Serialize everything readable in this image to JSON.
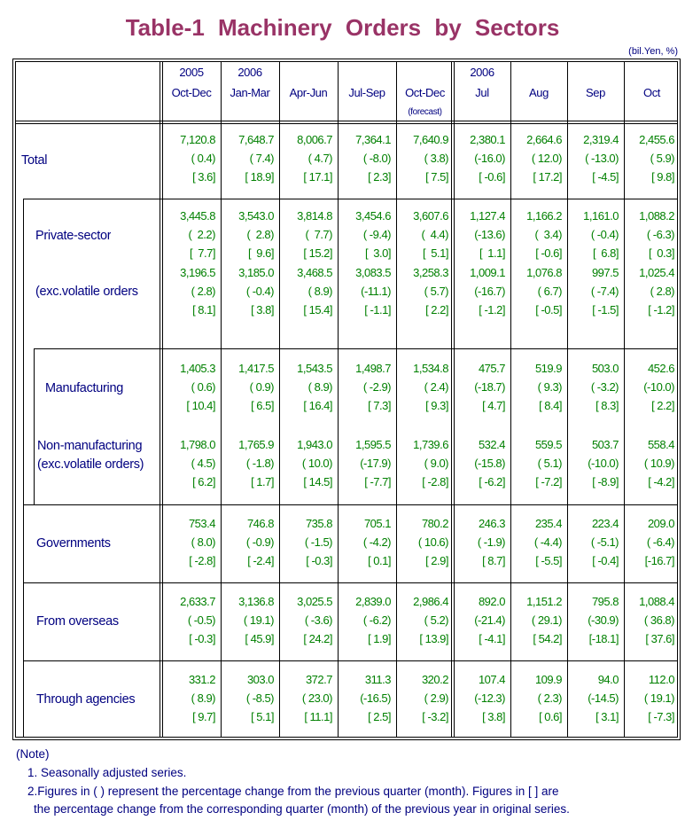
{
  "title": "Table-1  Machinery  Orders  by  Sectors",
  "unit": "(bil.Yen, %)",
  "columns": [
    {
      "top": "2005",
      "main": "Oct-Dec",
      "sub": ""
    },
    {
      "top": "2006",
      "main": "Jan-Mar",
      "sub": ""
    },
    {
      "top": "",
      "main": "Apr-Jun",
      "sub": ""
    },
    {
      "top": "",
      "main": "Jul-Sep",
      "sub": ""
    },
    {
      "top": "",
      "main": "Oct-Dec",
      "sub": "(forecast)"
    },
    {
      "top": "2006",
      "main": "Jul",
      "sub": ""
    },
    {
      "top": "",
      "main": "Aug",
      "sub": ""
    },
    {
      "top": "",
      "main": "Sep",
      "sub": ""
    },
    {
      "top": "",
      "main": "Oct",
      "sub": ""
    }
  ],
  "rows": [
    {
      "label": [
        "Total"
      ],
      "values": [
        "7,120.8",
        "7,648.7",
        "8,006.7",
        "7,364.1",
        "7,640.9",
        "2,380.1",
        "2,664.6",
        "2,319.4",
        "2,455.6"
      ],
      "qoq": [
        "( 0.4)",
        "( 7.4)",
        "( 4.7)",
        "( -8.0)",
        "( 3.8)",
        "(-16.0)",
        "( 12.0)",
        "( -13.0)",
        "( 5.9)"
      ],
      "yoy": [
        "[ 3.6]",
        "[ 18.9]",
        "[ 17.1]",
        "[ 2.3]",
        "[ 7.5]",
        "[ -0.6]",
        "[ 17.2]",
        "[ -4.5]",
        "[ 9.8]"
      ]
    },
    {
      "label": [
        "Private-sector"
      ],
      "values": [
        "3,445.8",
        "3,543.0",
        "3,814.8",
        "3,454.6",
        "3,607.6",
        "1,127.4",
        "1,166.2",
        "1,161.0",
        "1,088.2"
      ],
      "qoq": [
        "(  2.2)",
        "(  2.8)",
        "(  7.7)",
        "( -9.4)",
        "(  4.4)",
        "(-13.6)",
        "(  3.4)",
        "( -0.4)",
        "( -6.3)"
      ],
      "yoy": [
        "[  7.7]",
        "[  9.6]",
        "[ 15.2]",
        "[  3.0]",
        "[  5.1]",
        "[  1.1]",
        "[ -0.6]",
        "[  6.8]",
        "[  0.3]"
      ]
    },
    {
      "label": [
        "(exc.volatile orders"
      ],
      "values": [
        "3,196.5",
        "3,185.0",
        "3,468.5",
        "3,083.5",
        "3,258.3",
        "1,009.1",
        "1,076.8",
        "997.5",
        "1,025.4"
      ],
      "qoq": [
        "( 2.8)",
        "( -0.4)",
        "( 8.9)",
        "(-11.1)",
        "( 5.7)",
        "(-16.7)",
        "( 6.7)",
        "( -7.4)",
        "( 2.8)"
      ],
      "yoy": [
        "[ 8.1]",
        "[ 3.8]",
        "[ 15.4]",
        "[ -1.1]",
        "[ 2.2]",
        "[ -1.2]",
        "[ -0.5]",
        "[ -1.5]",
        "[ -1.2]"
      ]
    },
    {
      "label": [
        "Manufacturing"
      ],
      "values": [
        "1,405.3",
        "1,417.5",
        "1,543.5",
        "1,498.7",
        "1,534.8",
        "475.7",
        "519.9",
        "503.0",
        "452.6"
      ],
      "qoq": [
        "( 0.6)",
        "( 0.9)",
        "( 8.9)",
        "( -2.9)",
        "( 2.4)",
        "(-18.7)",
        "( 9.3)",
        "( -3.2)",
        "(-10.0)"
      ],
      "yoy": [
        "[ 10.4]",
        "[ 6.5]",
        "[ 16.4]",
        "[ 7.3]",
        "[ 9.3]",
        "[ 4.7]",
        "[ 8.4]",
        "[ 8.3]",
        "[ 2.2]"
      ]
    },
    {
      "label": [
        "Non-manufacturing",
        "(exc.volatile orders)"
      ],
      "values": [
        "1,798.0",
        "1,765.9",
        "1,943.0",
        "1,595.5",
        "1,739.6",
        "532.4",
        "559.5",
        "503.7",
        "558.4"
      ],
      "qoq": [
        "( 4.5)",
        "( -1.8)",
        "( 10.0)",
        "(-17.9)",
        "( 9.0)",
        "(-15.8)",
        "( 5.1)",
        "(-10.0)",
        "( 10.9)"
      ],
      "yoy": [
        "[ 6.2]",
        "[ 1.7]",
        "[ 14.5]",
        "[ -7.7]",
        "[ -2.8]",
        "[ -6.2]",
        "[ -7.2]",
        "[ -8.9]",
        "[ -4.2]"
      ]
    },
    {
      "label": [
        "Governments"
      ],
      "values": [
        "753.4",
        "746.8",
        "735.8",
        "705.1",
        "780.2",
        "246.3",
        "235.4",
        "223.4",
        "209.0"
      ],
      "qoq": [
        "( 8.0)",
        "( -0.9)",
        "( -1.5)",
        "( -4.2)",
        "( 10.6)",
        "( -1.9)",
        "( -4.4)",
        "( -5.1)",
        "( -6.4)"
      ],
      "yoy": [
        "[ -2.8]",
        "[ -2.4]",
        "[ -0.3]",
        "[ 0.1]",
        "[ 2.9]",
        "[ 8.7]",
        "[ -5.5]",
        "[ -0.4]",
        "[-16.7]"
      ]
    },
    {
      "label": [
        "From overseas"
      ],
      "values": [
        "2,633.7",
        "3,136.8",
        "3,025.5",
        "2,839.0",
        "2,986.4",
        "892.0",
        "1,151.2",
        "795.8",
        "1,088.4"
      ],
      "qoq": [
        "( -0.5)",
        "( 19.1)",
        "( -3.6)",
        "( -6.2)",
        "( 5.2)",
        "(-21.4)",
        "( 29.1)",
        "(-30.9)",
        "( 36.8)"
      ],
      "yoy": [
        "[ -0.3]",
        "[ 45.9]",
        "[ 24.2]",
        "[ 1.9]",
        "[ 13.9]",
        "[ -4.1]",
        "[ 54.2]",
        "[-18.1]",
        "[ 37.6]"
      ]
    },
    {
      "label": [
        "Through agencies"
      ],
      "values": [
        "331.2",
        "303.0",
        "372.7",
        "311.3",
        "320.2",
        "107.4",
        "109.9",
        "94.0",
        "112.0"
      ],
      "qoq": [
        "( 8.9)",
        "( -8.5)",
        "( 23.0)",
        "(-16.5)",
        "( 2.9)",
        "(-12.3)",
        "( 2.3)",
        "(-14.5)",
        "( 19.1)"
      ],
      "yoy": [
        "[ 9.7]",
        "[ 5.1]",
        "[ 11.1]",
        "[ 2.5]",
        "[ -3.2]",
        "[ 3.8]",
        "[ 0.6]",
        "[ 3.1]",
        "[ -7.3]"
      ]
    }
  ],
  "notes": {
    "heading": "(Note)",
    "items": [
      "1. Seasonally adjusted series.",
      "2.Figures in ( ) represent the percentage change from the previous quarter (month). Figures in [ ] are",
      "the percentage change from the corresponding quarter (month) of the previous year in original series."
    ]
  },
  "colors": {
    "title": "#993366",
    "label": "#000080",
    "value": "#008000"
  }
}
